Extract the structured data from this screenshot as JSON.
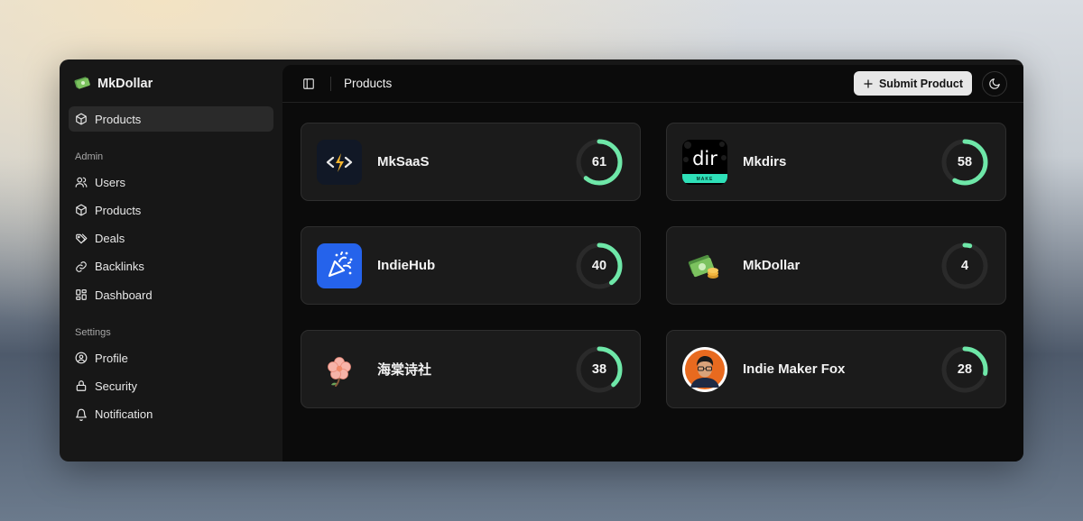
{
  "app": {
    "name": "MkDollar"
  },
  "sidebar": {
    "top_items": [
      {
        "label": "Products",
        "icon": "package-icon"
      }
    ],
    "admin_label": "Admin",
    "admin_items": [
      {
        "label": "Users",
        "icon": "users-icon"
      },
      {
        "label": "Products",
        "icon": "package-icon"
      },
      {
        "label": "Deals",
        "icon": "tags-icon"
      },
      {
        "label": "Backlinks",
        "icon": "link-icon"
      },
      {
        "label": "Dashboard",
        "icon": "dashboard-icon"
      }
    ],
    "settings_label": "Settings",
    "settings_items": [
      {
        "label": "Profile",
        "icon": "user-circle-icon"
      },
      {
        "label": "Security",
        "icon": "lock-icon"
      },
      {
        "label": "Notification",
        "icon": "bell-icon"
      }
    ]
  },
  "header": {
    "title": "Products",
    "submit_label": "Submit Product"
  },
  "products": [
    {
      "name": "MkSaaS",
      "score": 61
    },
    {
      "name": "Mkdirs",
      "score": 58,
      "logo_text": "dir",
      "logo_subtext": "MAKE"
    },
    {
      "name": "IndieHub",
      "score": 40
    },
    {
      "name": "MkDollar",
      "score": 4
    },
    {
      "name": "海棠诗社",
      "score": 38
    },
    {
      "name": "Indie Maker Fox",
      "score": 28
    }
  ],
  "colors": {
    "ring": "#6ee7a8",
    "ring_track": "#2a2a2a",
    "indiehub_blue": "#2563eb",
    "mksaas_bolt": "#f5b52e"
  }
}
